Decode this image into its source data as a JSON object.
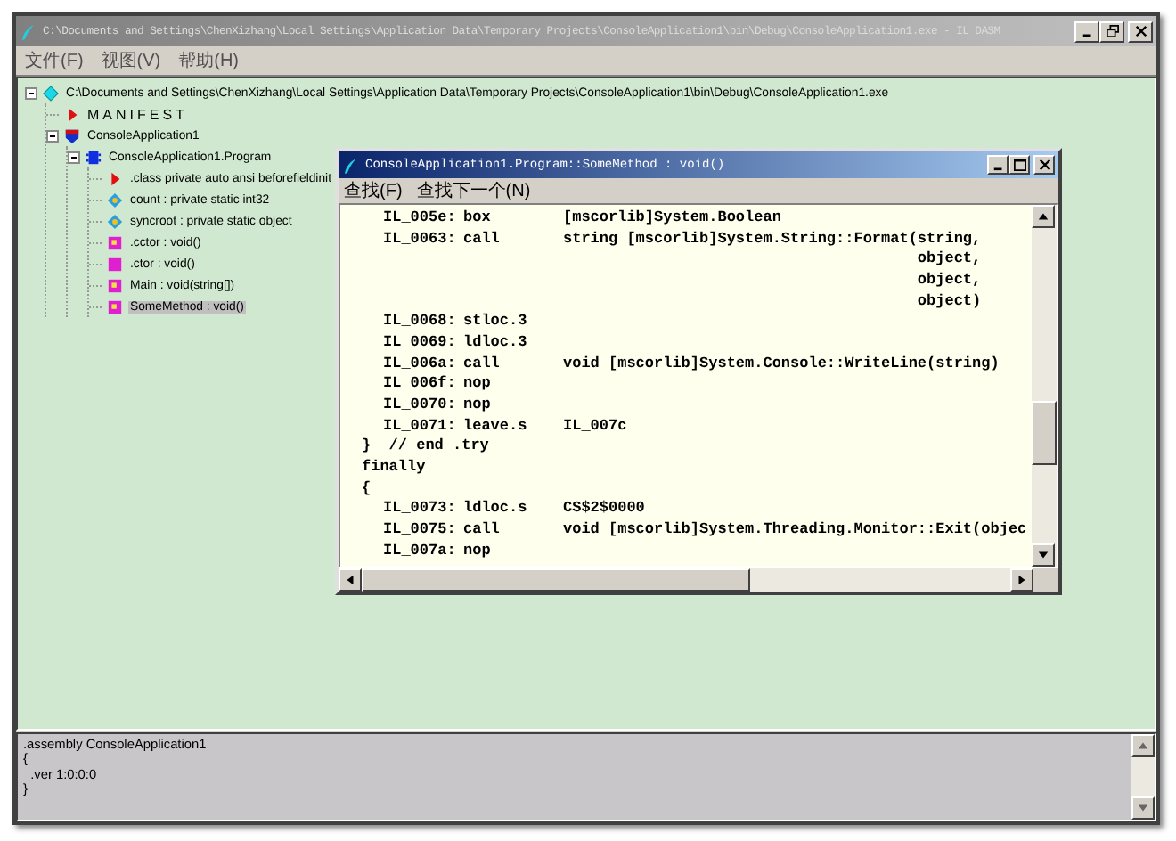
{
  "window": {
    "title": "C:\\Documents and Settings\\ChenXizhang\\Local Settings\\Application Data\\Temporary Projects\\ConsoleApplication1\\bin\\Debug\\ConsoleApplication1.exe - IL DASM"
  },
  "menu": [
    "文件(F)",
    "视图(V)",
    "帮助(H)"
  ],
  "tree": [
    {
      "kind": "file",
      "label": "C:\\Documents and Settings\\ChenXizhang\\Local Settings\\Application Data\\Temporary Projects\\ConsoleApplication1\\bin\\Debug\\ConsoleApplication1.exe",
      "expanded": true,
      "selected": false,
      "children": [
        {
          "kind": "manifest",
          "label": "MANIFEST",
          "selected": false
        },
        {
          "kind": "namespace",
          "label": "ConsoleApplication1",
          "expanded": true,
          "selected": false,
          "children": [
            {
              "kind": "class",
              "label": "ConsoleApplication1.Program",
              "expanded": true,
              "selected": false,
              "children": [
                {
                  "kind": "info",
                  "label": ".class private auto ansi beforefieldinit",
                  "selected": false
                },
                {
                  "kind": "field",
                  "label": "count : private static int32",
                  "selected": false
                },
                {
                  "kind": "field",
                  "label": "syncroot : private static object",
                  "selected": false
                },
                {
                  "kind": "static-method",
                  "label": ".cctor : void()",
                  "selected": false
                },
                {
                  "kind": "method",
                  "label": ".ctor : void()",
                  "selected": false
                },
                {
                  "kind": "static-method",
                  "label": "Main : void(string[])",
                  "selected": false
                },
                {
                  "kind": "static-method",
                  "label": "SomeMethod : void()",
                  "selected": true
                }
              ]
            }
          ]
        }
      ]
    }
  ],
  "code_window": {
    "title": "ConsoleApplication1.Program::SomeMethod : void()",
    "menu": [
      "查找(F)",
      "查找下一个(N)"
    ],
    "lines": [
      {
        "kind": "instr",
        "label": "IL_005e:",
        "op": "box",
        "arg": "[mscorlib]System.Boolean"
      },
      {
        "kind": "instr",
        "label": "IL_0063:",
        "op": "call",
        "arg": "string [mscorlib]System.String::Format(string,"
      },
      {
        "kind": "cont",
        "text": "object,"
      },
      {
        "kind": "cont",
        "text": "object,"
      },
      {
        "kind": "cont",
        "text": "object)"
      },
      {
        "kind": "instr",
        "label": "IL_0068:",
        "op": "stloc.3"
      },
      {
        "kind": "instr",
        "label": "IL_0069:",
        "op": "ldloc.3"
      },
      {
        "kind": "instr",
        "label": "IL_006a:",
        "op": "call",
        "arg": "void [mscorlib]System.Console::WriteLine(string)"
      },
      {
        "kind": "instr",
        "label": "IL_006f:",
        "op": "nop"
      },
      {
        "kind": "instr",
        "label": "IL_0070:",
        "op": "nop"
      },
      {
        "kind": "instr",
        "label": "IL_0071:",
        "op": "leave.s",
        "arg": "IL_007c"
      },
      {
        "kind": "text",
        "text": "}  // end .try"
      },
      {
        "kind": "text",
        "text": "finally"
      },
      {
        "kind": "text",
        "text": "{"
      },
      {
        "kind": "instr",
        "label": "IL_0073:",
        "op": "ldloc.s",
        "arg": "CS$2$0000"
      },
      {
        "kind": "instr",
        "label": "IL_0075:",
        "op": "call",
        "arg": "void [mscorlib]System.Threading.Monitor::Exit(objec"
      },
      {
        "kind": "instr",
        "label": "IL_007a:",
        "op": "nop"
      }
    ]
  },
  "info_panel": {
    "lines": [
      ".assembly ConsoleApplication1",
      "{",
      "  .ver 1:0:0:0",
      "}"
    ]
  }
}
